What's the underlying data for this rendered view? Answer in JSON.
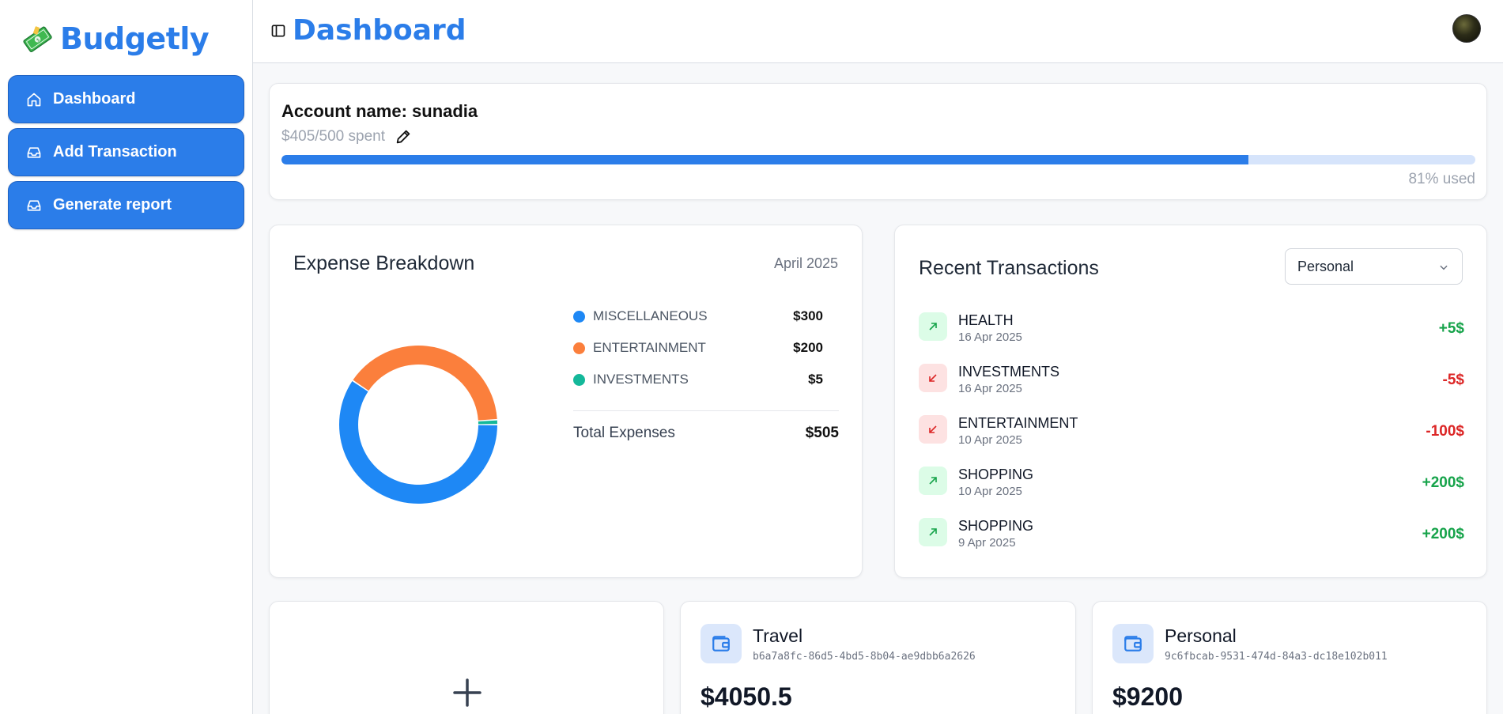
{
  "app": {
    "name": "Budgetly"
  },
  "sidebar": {
    "items": [
      {
        "label": "Dashboard",
        "icon": "home-icon"
      },
      {
        "label": "Add Transaction",
        "icon": "inbox-icon"
      },
      {
        "label": "Generate report",
        "icon": "inbox-icon"
      }
    ]
  },
  "header": {
    "title": "Dashboard"
  },
  "account": {
    "name_label": "Account name: sunadia",
    "spent_text": "$405/500 spent",
    "used_text": "81% used",
    "used_fraction": 0.81
  },
  "expense": {
    "title": "Expense Breakdown",
    "month": "April 2025",
    "total_label": "Total Expenses",
    "total_value": "$505"
  },
  "chart_data": {
    "type": "pie",
    "categories": [
      "MISCELLANEOUS",
      "ENTERTAINMENT",
      "INVESTMENTS"
    ],
    "values": [
      300,
      200,
      5
    ],
    "value_labels": [
      "$300",
      "$200",
      "$5"
    ],
    "colors": [
      "#1e88f5",
      "#fb7f3c",
      "#14b89a"
    ]
  },
  "transactions": {
    "title": "Recent Transactions",
    "filter": "Personal",
    "items": [
      {
        "category": "HEALTH",
        "date": "16 Apr 2025",
        "amount": "+5$",
        "direction": "in"
      },
      {
        "category": "INVESTMENTS",
        "date": "16 Apr 2025",
        "amount": "-5$",
        "direction": "out"
      },
      {
        "category": "ENTERTAINMENT",
        "date": "10 Apr 2025",
        "amount": "-100$",
        "direction": "out"
      },
      {
        "category": "SHOPPING",
        "date": "10 Apr 2025",
        "amount": "+200$",
        "direction": "in"
      },
      {
        "category": "SHOPPING",
        "date": "9 Apr 2025",
        "amount": "+200$",
        "direction": "in"
      }
    ]
  },
  "wallets": [
    {
      "name": "Travel",
      "id": "b6a7a8fc-86d5-4bd5-8b04-ae9dbb6a2626",
      "balance": "$4050.5"
    },
    {
      "name": "Personal",
      "id": "9c6fbcab-9531-474d-84a3-dc18e102b011",
      "balance": "$9200"
    }
  ]
}
